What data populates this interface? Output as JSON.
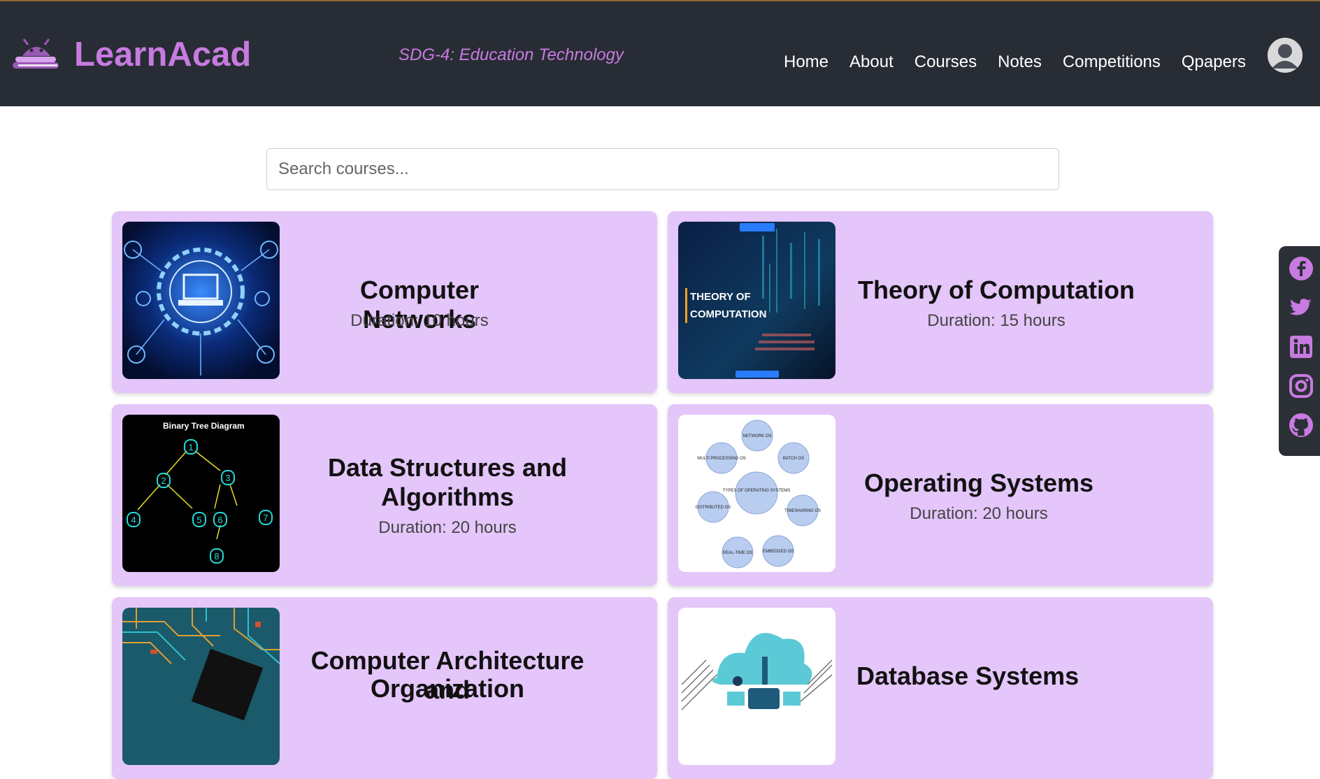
{
  "brand": {
    "name": "LearnAcad",
    "tagline": "SDG-4: Education Technology"
  },
  "nav": {
    "items": [
      "Home",
      "About",
      "Courses",
      "Notes",
      "Competitions",
      "Qpapers"
    ]
  },
  "search": {
    "placeholder": "Search courses..."
  },
  "courses": [
    {
      "title": "Computer Networks",
      "duration": "Duration: 10 hours",
      "image": "network-laptop-image"
    },
    {
      "title": "Theory of Computation",
      "duration": "Duration: 15 hours",
      "image": "theory-of-computation-image",
      "image_text": [
        "THEORY OF",
        "COMPUTATION"
      ]
    },
    {
      "title_line1": "Data Structures and",
      "title_line2": "Algorithms",
      "duration": "Duration: 20 hours",
      "image": "binary-tree-image",
      "image_text": "Binary Tree Diagram"
    },
    {
      "title": "Operating Systems",
      "duration": "Duration: 20 hours",
      "image": "os-types-diagram-image",
      "image_text": {
        "center": "TYPES OF OPERATING SYSTEMS",
        "nodes": [
          "NETWORK OS",
          "BATCH OS",
          "TIMESHARING OS",
          "EMBEDDED OS",
          "REAL-TIME OS",
          "DISTRIBUTED OS",
          "MULTI PROCESSING OS"
        ]
      }
    },
    {
      "title_line1": "Computer Architecture and",
      "title_line2": "Organization",
      "image": "circuit-board-image"
    },
    {
      "title": "Database Systems",
      "image": "cloud-database-image"
    }
  ],
  "social": [
    "facebook-icon",
    "twitter-icon",
    "linkedin-icon",
    "instagram-icon",
    "github-icon"
  ],
  "colors": {
    "header_bg": "#282c34",
    "accent": "#c77be0",
    "card_bg": "#e4c6fa"
  }
}
